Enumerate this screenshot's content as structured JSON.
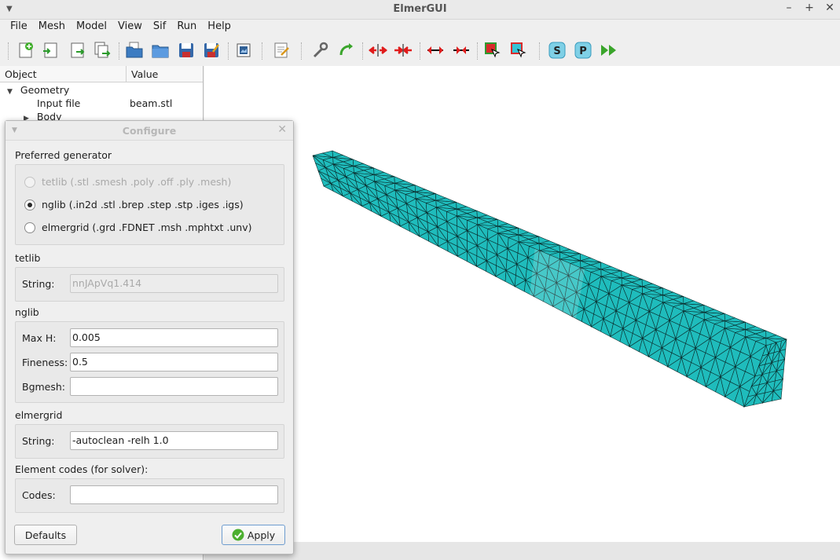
{
  "window": {
    "title": "ElmerGUI"
  },
  "menubar": {
    "items": [
      "File",
      "Mesh",
      "Model",
      "View",
      "Sif",
      "Run",
      "Help"
    ]
  },
  "toolbar": {
    "icons": [
      "new-icon",
      "open-geometry-icon",
      "load-mesh-icon",
      "save-mesh-icon",
      "open-project-icon",
      "folder-icon",
      "save-icon",
      "save-as-icon",
      "snapshot-icon",
      "edit-sif-icon",
      "wrench-icon",
      "remesh-icon",
      "divide-surface-icon",
      "unify-surface-icon",
      "divide-edge-icon",
      "unify-edge-icon",
      "select-bodies-icon",
      "select-surfaces-icon",
      "solver-icon",
      "postprocessor-icon",
      "run-icon"
    ]
  },
  "tree": {
    "header": {
      "object": "Object",
      "value": "Value"
    },
    "rows": [
      {
        "label": "Geometry",
        "value": ""
      },
      {
        "label": "Input file",
        "value": "beam.stl"
      },
      {
        "label": "Body",
        "value": ""
      }
    ]
  },
  "dialog": {
    "title": "Configure",
    "preferred_label": "Preferred generator",
    "generators": [
      {
        "label": "tetlib (.stl .smesh .poly .off .ply .mesh)",
        "checked": false,
        "disabled": true
      },
      {
        "label": "nglib (.in2d .stl .brep .step .stp .iges .igs)",
        "checked": true,
        "disabled": false
      },
      {
        "label": "elmergrid (.grd .FDNET .msh .mphtxt .unv)",
        "checked": false,
        "disabled": false
      }
    ],
    "tetlib": {
      "section": "tetlib",
      "string_label": "String:",
      "string_value": "nnJApVq1.414"
    },
    "nglib": {
      "section": "nglib",
      "maxh_label": "Max H:",
      "maxh_value": "0.005",
      "fineness_label": "Fineness:",
      "fineness_value": "0.5",
      "bgmesh_label": "Bgmesh:",
      "bgmesh_value": ""
    },
    "elmergrid": {
      "section": "elmergrid",
      "string_label": "String:",
      "string_value": "-autoclean -relh 1.0"
    },
    "codes": {
      "section": "Element codes (for solver):",
      "codes_label": "Codes:",
      "codes_value": ""
    },
    "defaults_label": "Defaults",
    "apply_label": "Apply"
  },
  "colors": {
    "mesh_fill": "#1fbcbc",
    "mesh_edge": "#0a2a2a",
    "apply_check": "#4caf2f"
  }
}
